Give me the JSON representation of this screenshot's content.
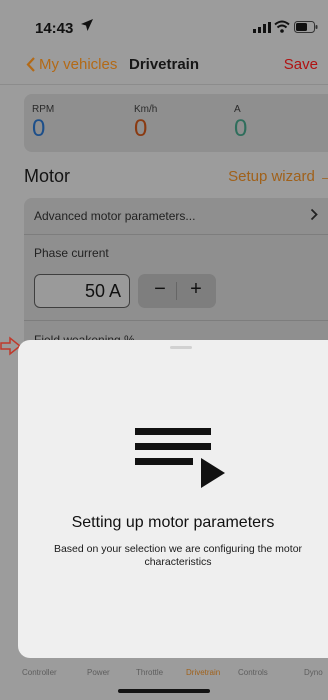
{
  "status_bar": {
    "time": "14:43"
  },
  "nav": {
    "back_label": "My vehicles",
    "title": "Drivetrain",
    "save_label": "Save"
  },
  "gauges": [
    {
      "label": "RPM",
      "value": "0",
      "color": "#1d4f8a"
    },
    {
      "label": "Km/h",
      "value": "0",
      "color": "#8a3a11"
    },
    {
      "label": "A",
      "value": "0",
      "color": "#2f6e5c"
    }
  ],
  "motor": {
    "title": "Motor",
    "setup_wizard": "Setup wizard →",
    "advanced_label": "Advanced motor parameters...",
    "phase_current_label": "Phase current",
    "phase_current_value": "50 A",
    "minus_label": "−",
    "plus_label": "+",
    "field_weakening_label": "Field weakening %"
  },
  "sheet": {
    "title": "Setting up motor parameters",
    "description": "Based on your selection we are configuring the motor characteristics"
  },
  "tabs": [
    {
      "label": "Controller",
      "active": false
    },
    {
      "label": "Power",
      "active": false
    },
    {
      "label": "Throttle",
      "active": false
    },
    {
      "label": "Drivetrain",
      "active": true
    },
    {
      "label": "Controls",
      "active": false
    },
    {
      "label": "Dyno",
      "active": false
    }
  ],
  "colors": {
    "accent": "#a0611a",
    "save": "#b01212",
    "sheet_bg": "#efefef"
  }
}
